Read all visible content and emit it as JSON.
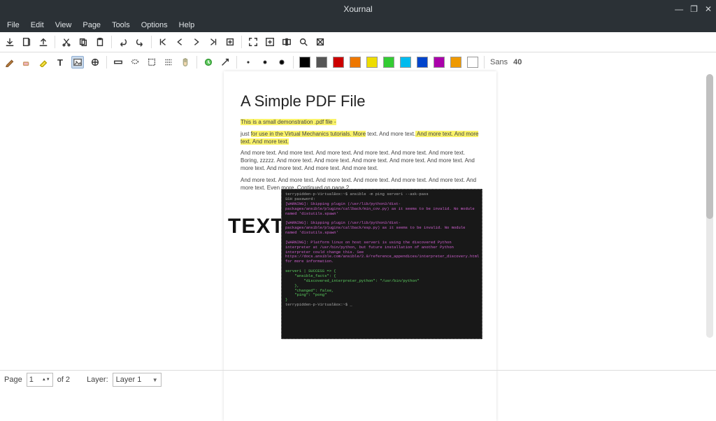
{
  "window": {
    "title": "Xournal"
  },
  "menu": {
    "items": [
      "File",
      "Edit",
      "View",
      "Page",
      "Tools",
      "Options",
      "Help"
    ]
  },
  "toolbar_icons": [
    "save",
    "new",
    "open",
    "cut",
    "copy",
    "paste",
    "undo",
    "redo",
    "first",
    "prev",
    "next",
    "last",
    "page",
    "fullscreen",
    "zoom-fit",
    "zoom-width",
    "zoom-in",
    "zoom-out"
  ],
  "tool_icons": [
    "pen",
    "eraser",
    "highlighter",
    "text",
    "image",
    "shapes",
    "ruler",
    "select-rect",
    "select-region",
    "select-vert",
    "hand",
    "default",
    "arrow",
    "fine",
    "medium",
    "thick"
  ],
  "colors": [
    "#000000",
    "#555555",
    "#cc0000",
    "#ee7700",
    "#eedd00",
    "#33cc33",
    "#00bbee",
    "#0044cc",
    "#aa00aa",
    "#ee9900",
    "#ffffff"
  ],
  "font": {
    "name": "Sans",
    "size": "40"
  },
  "status": {
    "page_label": "Page",
    "page_current": "1",
    "page_of": "of 2",
    "layer_label": "Layer:",
    "layer_value": "Layer 1"
  },
  "doc": {
    "title": "A Simple PDF File",
    "line1_hl": "This is a small demonstration .pdf file -",
    "line2_pre": "just ",
    "line2_hl": "for use in the Virtual Mechanics tutorials. More",
    "line2_post": " text. And more text.",
    "line3_hl": " And more text. And more text. And more text.",
    "para2": "And more text. And more text. And more text. And more text. And more text. And more text. Boring, zzzzz. And more text. And more text. And more text. And more text. And more text. And more text. And more text. And more text. And more text.",
    "para3": "And more text. And more text. And more text. And more text. And more text. And more text. And more text. Even more. Continued on page 2 ...",
    "bigtext": "TEXT"
  },
  "terminal": {
    "l1": "terrypidden-p-VirtualBox:~$ ansible -m ping server1 --ask-pass",
    "l2": "SSH password:",
    "l3": "[WARNING]: Skipping plugin (/usr/lib/python3/dist-packages/ansible/plugins/callback/min_cov.py) as it seems to be invalid. No module named 'distutils.spawn'",
    "l4": "[WARNING]: Skipping plugin (/usr/lib/python3/dist-packages/ansible/plugins/callback/esp.py) as it seems to be invalid. No module named 'distutils.spawn'",
    "l5": "[WARNING]: Platform linux on host server1 is using the discovered Python interpreter at /usr/bin/python, but future installation of another Python interpreter could change this. See https://docs.ansible.com/ansible/2.9/reference_appendices/interpreter_discovery.html for more information.",
    "l6": "server1 | SUCCESS => {",
    "l7": "    \"ansible_facts\": {",
    "l8": "        \"discovered_interpreter_python\": \"/usr/bin/python\"",
    "l9": "    },",
    "l10": "    \"changed\": false,",
    "l11": "    \"ping\": \"pong\"",
    "l12": "}",
    "l13": "terrypidden-p-VirtualBox:~$ _"
  }
}
